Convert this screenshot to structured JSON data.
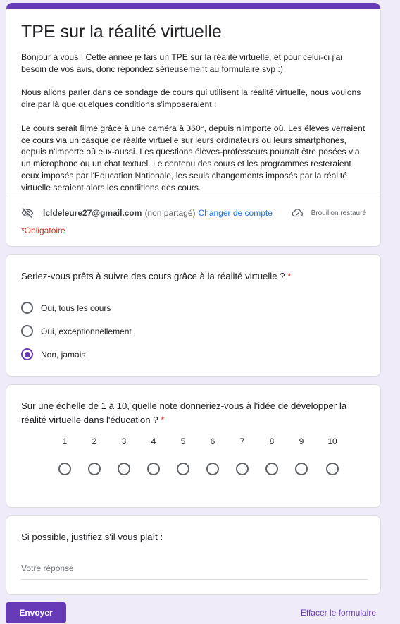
{
  "form": {
    "title": "TPE sur la réalité virtuelle",
    "description": [
      "Bonjour à vous ! Cette année je fais un TPE sur la réalité virtuelle, et pour celui-ci j'ai besoin de vos avis, donc répondez sérieusement au formulaire svp :)",
      "Nous allons parler dans ce sondage de cours qui utilisent la réalité virtuelle, nous voulons dire par là que quelques conditions s'imposeraient :",
      "Le cours serait filmé grâce à une caméra à 360°, depuis n'importe où. Les élèves verraient ce cours via un casque de réalité virtuelle sur leurs ordinateurs ou leurs smartphones, depuis n'importe où eux-aussi. Les questions élèves-professeurs pourrait être posées via un microphone ou un chat textuel. Le contenu des cours et les programmes resteraient ceux imposés par l'Education Nationale, les seuls changements imposés par la réalité virtuelle seraient alors les conditions des cours."
    ],
    "account": {
      "email": "lcldeleure27@gmail.com",
      "not_shared": "(non partagé)",
      "switch_label": "Changer de compte"
    },
    "draft_status": "Brouillon restauré",
    "required_note": "*Obligatoire",
    "accent_color": "#673ab7"
  },
  "questions": {
    "q1": {
      "title": "Seriez-vous prêts à suivre des cours grâce à la réalité virtuelle ?",
      "required_mark": "*",
      "options": [
        "Oui, tous les cours",
        "Oui, exceptionnellement",
        "Non, jamais"
      ],
      "selected": "Non, jamais"
    },
    "q2": {
      "title": "Sur une échelle de 1 à 10, quelle note donneriez-vous à l'idée de développer la réalité virtuelle dans l'éducation ?",
      "required_mark": "*",
      "scale": [
        "1",
        "2",
        "3",
        "4",
        "5",
        "6",
        "7",
        "8",
        "9",
        "10"
      ]
    },
    "q3": {
      "title": "Si possible, justifiez s'il vous plaît :",
      "placeholder": "Votre réponse",
      "value": ""
    }
  },
  "actions": {
    "submit_label": "Envoyer",
    "clear_label": "Effacer le formulaire"
  },
  "icons": {
    "eye_off": "eye-off-icon",
    "cloud_check": "cloud-check-icon"
  }
}
